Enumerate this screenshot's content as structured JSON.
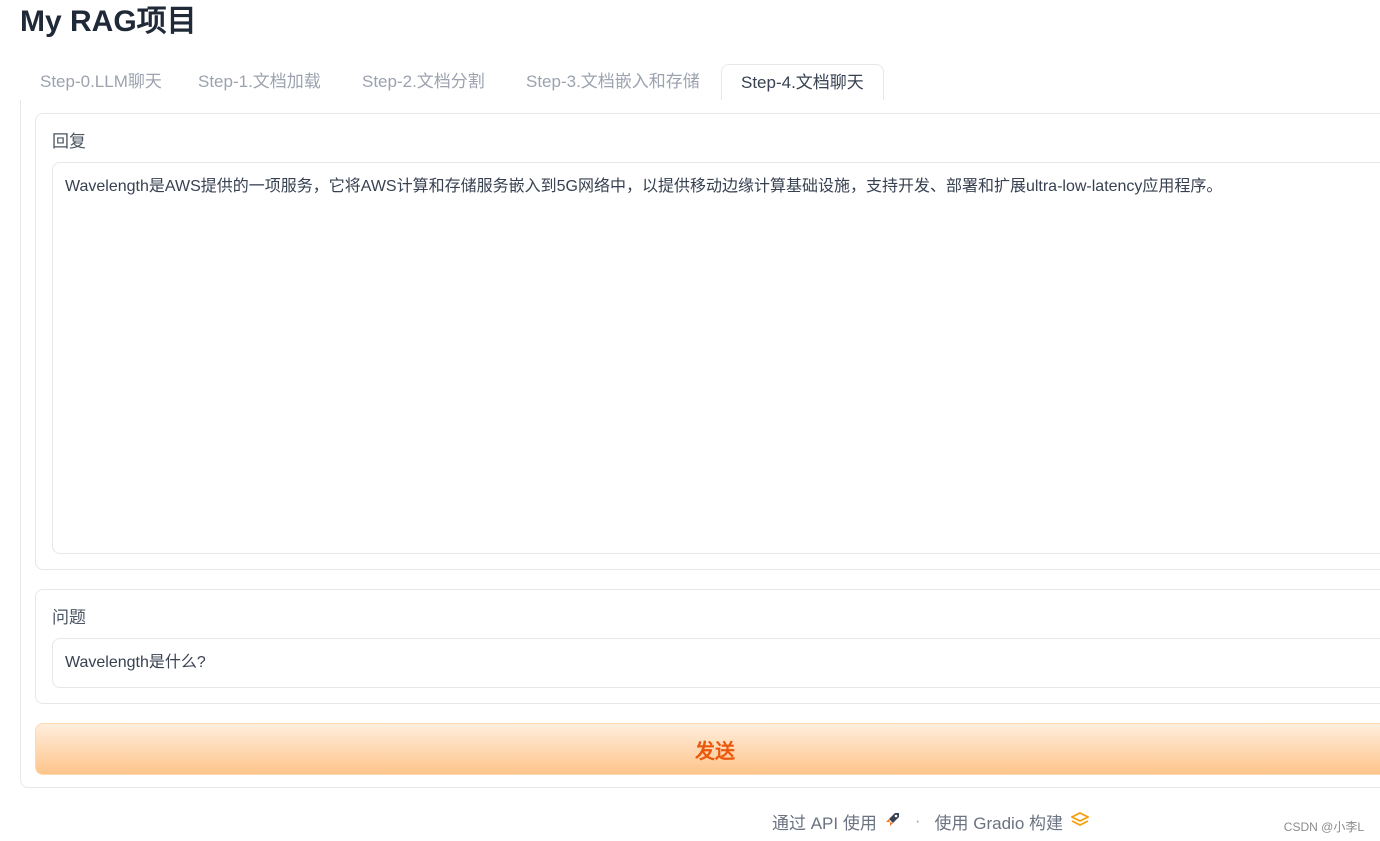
{
  "title": "My RAG项目",
  "tabs": [
    {
      "label": "Step-0.LLM聊天"
    },
    {
      "label": "Step-1.文档加载"
    },
    {
      "label": "Step-2.文档分割"
    },
    {
      "label": "Step-3.文档嵌入和存储"
    },
    {
      "label": "Step-4.文档聊天"
    }
  ],
  "active_tab": "Step-4.文档聊天",
  "reply": {
    "label": "回复",
    "value": "Wavelength是AWS提供的一项服务，它将AWS计算和存储服务嵌入到5G网络中，以提供移动边缘计算基础设施，支持开发、部署和扩展ultra-low-latency应用程序。"
  },
  "question": {
    "label": "问题",
    "value": "Wavelength是什么?"
  },
  "send_button": {
    "label": "发送"
  },
  "footer": {
    "api_label": "通过 API 使用",
    "separator": "·",
    "built_label": "使用 Gradio 构建",
    "api_icon": "rocket-icon",
    "gradio_icon": "gradio-logo-icon"
  },
  "watermark": "CSDN @小李L",
  "colors": {
    "accent": "#ea580c",
    "button_gradient_top": "#ffeedd",
    "button_gradient_bottom": "#fdc48a",
    "border": "#e5e7eb"
  }
}
